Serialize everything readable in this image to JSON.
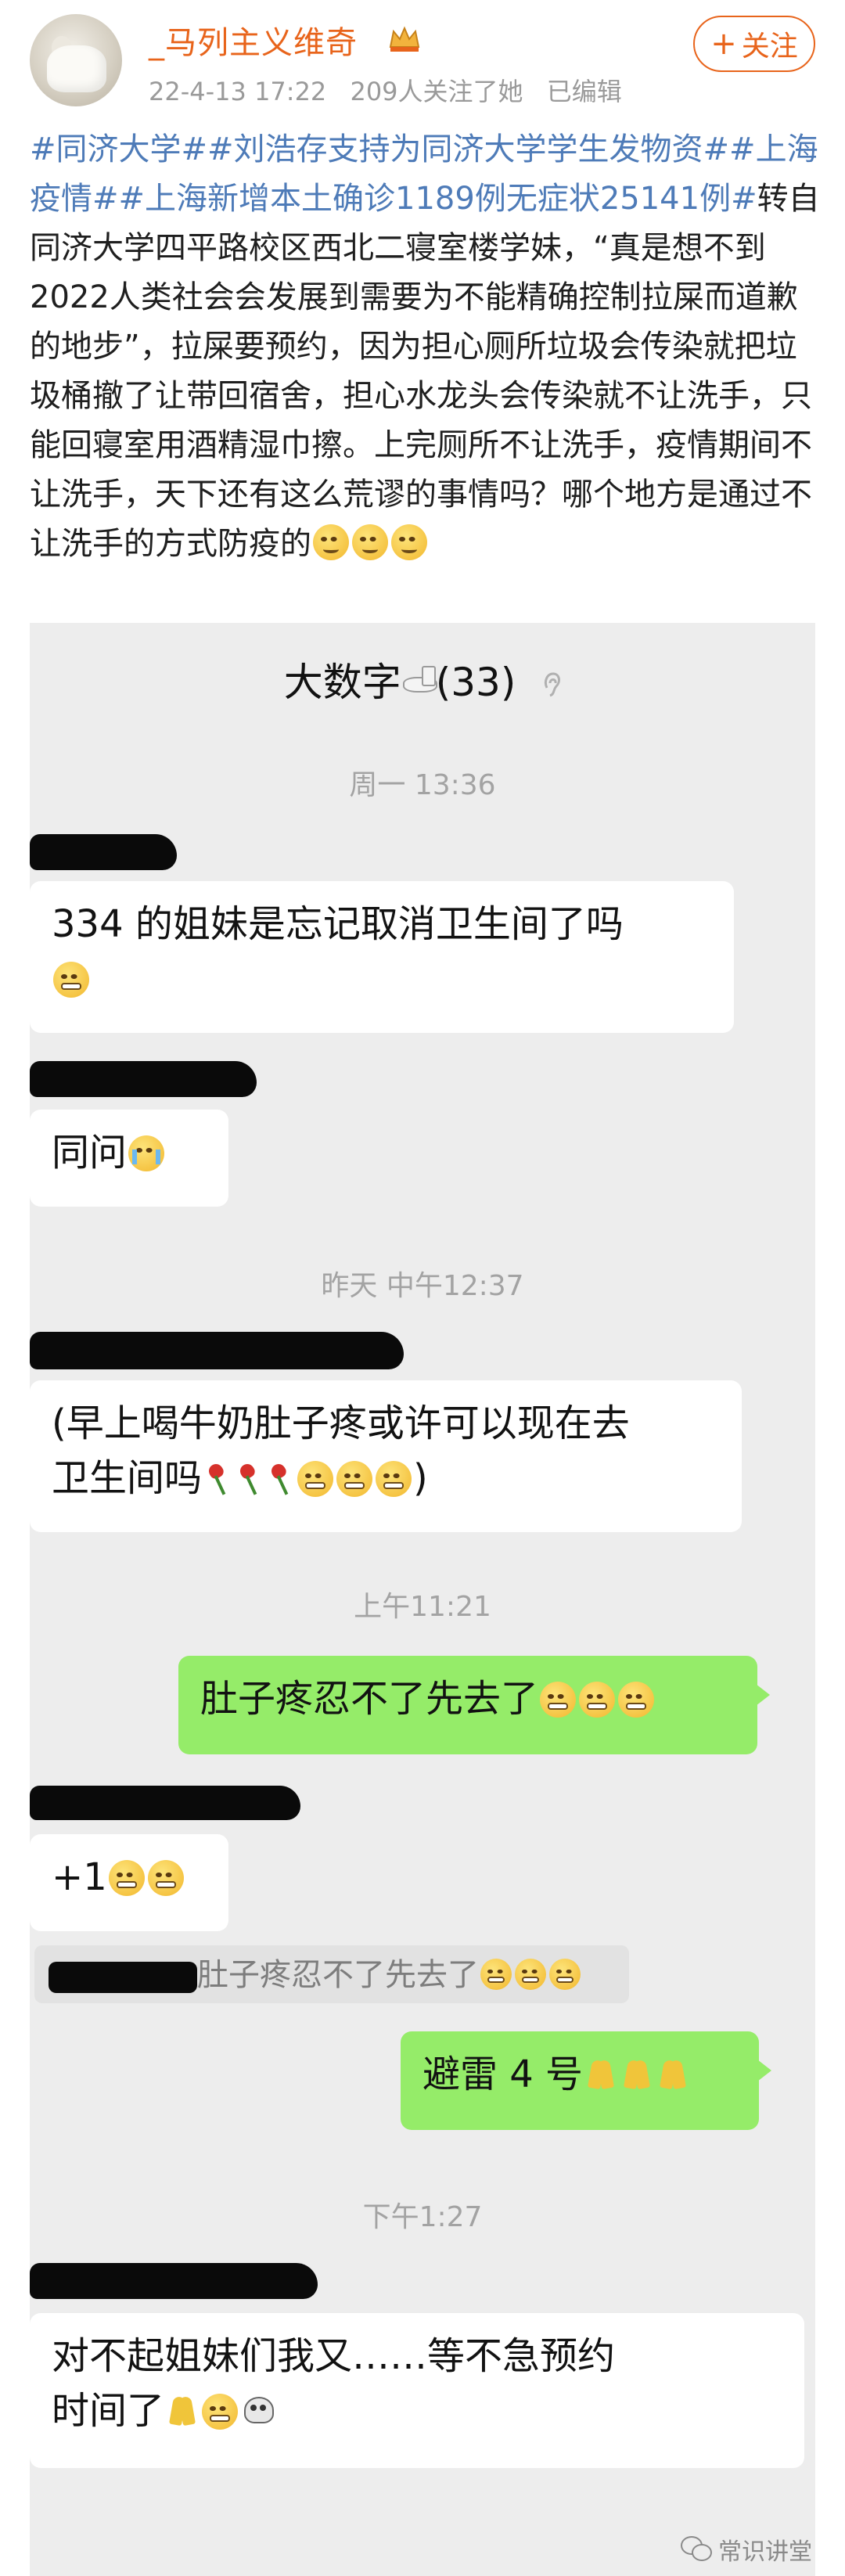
{
  "header": {
    "username": "_马列主义维奇",
    "verified_badge_icon": "crown-badge-icon",
    "meta": {
      "time": "22-4-13 17:22",
      "followers": "209人关注了她",
      "edited": "已编辑"
    },
    "follow_label": "关注",
    "follow_plus": "+"
  },
  "post": {
    "tags_line": "#同济大学##刘浩存支持为同济大学学生发物资##上海疫情##上海新增本土确诊1189例无症状25141例#",
    "body": "转自同济大学四平路校区西北二寝室楼学妹，“真是想不到2022人类社会会发展到需要为不能精确控制拉屎而道歉的地步”，拉屎要预约，因为担心厕所垃圾会传染就把垃圾桶撤了让带回宿舍，担心水龙头会传染就不让洗手，只能回寝室用酒精湿巾擦。上完厕所不让洗手，疫情期间不让洗手，天下还有这么荒谬的事情吗？哪个地方是通过不让洗手的方式防疫的",
    "trailing_emoji": [
      "sweat-smile-icon",
      "sweat-smile-icon",
      "sweat-smile-icon"
    ]
  },
  "chat": {
    "title_prefix": "大数字",
    "title_suffix": "(33)",
    "title_icon": "toilet-icon",
    "muted_icon": "ear-icon",
    "timestamps": [
      "周一 13:36",
      "昨天 中午12:37",
      "上午11:21",
      "下午1:27"
    ],
    "messages": {
      "m1_text": "334 的姐妹是忘记取消卫生间了吗",
      "m2_text": "同问",
      "m3_text_a": "(早上喝牛奶肚子疼或许可以现在去",
      "m3_text_b": "卫生间吗",
      "m3_text_close": ")",
      "m4_text": "肚子疼忍不了先去了",
      "m5_text": "+1",
      "m6_quote": "肚子疼忍不了先去了",
      "m7_text": "避雷 4 号",
      "m8_text_a": "对不起姐妹们我又……等不急预约",
      "m8_text_b": "时间了"
    }
  },
  "watermark": {
    "icon": "wechat-icon",
    "text": "常识讲堂"
  },
  "colors": {
    "accent": "#e8641b",
    "hashtag": "#4e7bb8",
    "chat_bg": "#ededed",
    "bubble_self": "#95ec69",
    "bubble_other": "#ffffff"
  }
}
